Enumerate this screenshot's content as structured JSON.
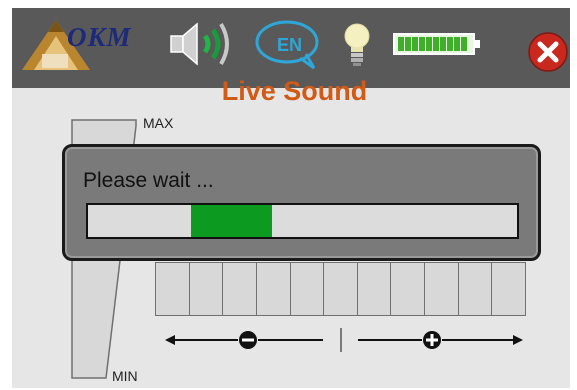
{
  "header": {
    "logo_text": "OKM",
    "language_label": "EN"
  },
  "screen": {
    "title": "Live Sound",
    "max_label": "MAX",
    "min_label": "MIN",
    "bar_count": 11
  },
  "dialog": {
    "message": "Please wait ...",
    "progress_start": 0.24,
    "progress_end": 0.43
  },
  "colors": {
    "accent_orange": "#d05a16",
    "progress_green": "#0c9a21",
    "close_red": "#c8281e",
    "battery_green": "#3fae2a"
  },
  "icons": [
    "okm-logo-icon",
    "speaker-volume-icon",
    "language-bubble-icon",
    "lightbulb-icon",
    "battery-icon",
    "close-icon",
    "minus-icon",
    "plus-icon"
  ]
}
